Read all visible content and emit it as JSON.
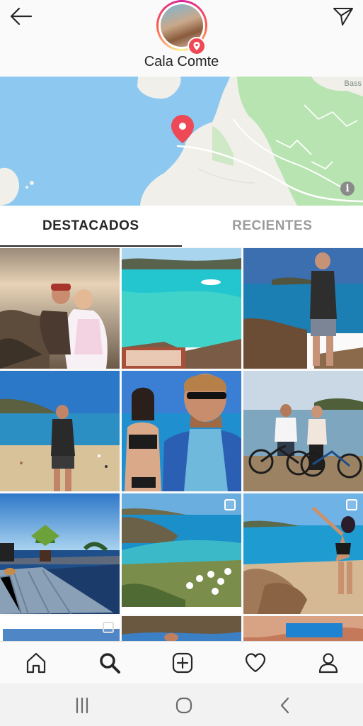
{
  "header": {
    "title": "Cala Comte",
    "back_icon": "arrow-left-icon",
    "send_icon": "paper-plane-icon",
    "badge_icon": "location-pin-icon"
  },
  "map": {
    "corner_label": "Bass",
    "info_icon": "info-icon",
    "info_glyph": "i",
    "pin_color": "#ed4956",
    "water_color": "#8cc8f0",
    "land_color": "#f0efe9",
    "park_color": "#b7e4b0"
  },
  "tabs": [
    {
      "label": "DESTACADOS",
      "active": true
    },
    {
      "label": "RECIENTES",
      "active": false
    }
  ],
  "grid": {
    "tiles": [
      {
        "subject": "couple-on-rocks-sunset",
        "multi": false
      },
      {
        "subject": "turquoise-cove-boat",
        "multi": false
      },
      {
        "subject": "man-standing-on-rocks",
        "multi": false
      },
      {
        "subject": "man-on-beach",
        "multi": false
      },
      {
        "subject": "couple-selfie",
        "multi": false
      },
      {
        "subject": "couple-with-bikes",
        "multi": false
      },
      {
        "subject": "wooden-deck-pool",
        "multi": false
      },
      {
        "subject": "cove-with-flowers",
        "multi": true
      },
      {
        "subject": "woman-on-rocks",
        "multi": true
      },
      {
        "subject": "partial-photo-sky",
        "multi": true
      },
      {
        "subject": "partial-photo-cliff",
        "multi": false
      },
      {
        "subject": "partial-photo-rock",
        "multi": false
      }
    ]
  },
  "bottom_nav": [
    {
      "name": "home-icon"
    },
    {
      "name": "search-icon",
      "active": true
    },
    {
      "name": "add-post-icon"
    },
    {
      "name": "heart-icon"
    },
    {
      "name": "profile-icon"
    }
  ],
  "system_nav": [
    {
      "name": "recent-apps-icon"
    },
    {
      "name": "home-circle-icon"
    },
    {
      "name": "system-back-icon"
    }
  ],
  "colors": {
    "accent_red": "#ed4956",
    "text_primary": "#262626",
    "text_inactive": "#9b9b9b"
  }
}
